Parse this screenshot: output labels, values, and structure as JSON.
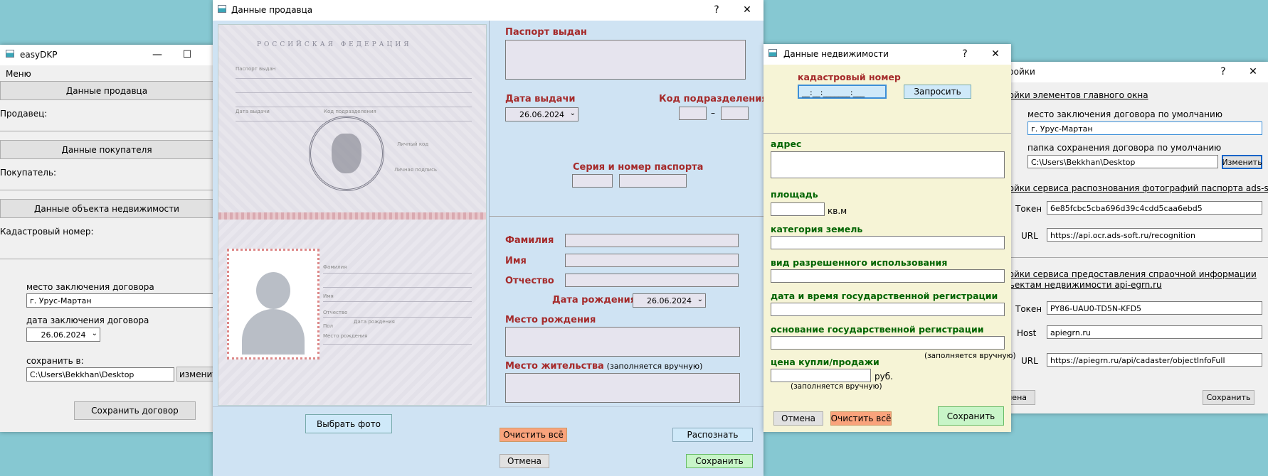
{
  "main_window": {
    "title": "easyDKP",
    "menu": "Меню",
    "seller_button": "Данные продавца",
    "seller_label": "Продавец:",
    "buyer_button": "Данные покупателя",
    "buyer_label": "Покупатель:",
    "property_button": "Данные объекта недвижимости",
    "cadastral_label": "Кадастровый номер:",
    "place_label": "место заключения договора",
    "place_value": "г. Урус-Мартан",
    "date_label": "дата заключения договора",
    "date_value": "26.06.2024",
    "save_to_label": "сохранить в:",
    "save_path": "C:\\Users\\Bekkhan\\Desktop",
    "change_button": "изменить",
    "save_contract_button": "Сохранить договор"
  },
  "seller_dialog": {
    "title": "Данные продавца",
    "help": "?",
    "close": "✕",
    "passport_image": {
      "header": "РОССИЙСКАЯ ФЕДЕРАЦИЯ",
      "issued_by": "Паспорт выдан",
      "issue_date": "Дата выдачи",
      "division_code": "Код подразделения",
      "personal_code": "Личный код",
      "personal_signature": "Личная подпись",
      "surname": "Фамилия",
      "name": "Имя",
      "patronymic": "Отчество",
      "sex": "Пол",
      "birth_date": "Дата рождения",
      "birth_place": "Место рождения"
    },
    "issued_by_label": "Паспорт выдан",
    "issue_date_label": "Дата выдачи",
    "issue_date_value": "26.06.2024",
    "division_code_label": "Код подразделения",
    "division_dash": "–",
    "series_label": "Серия и номер паспорта",
    "surname_label": "Фамилия",
    "name_label": "Имя",
    "patronymic_label": "Отчество",
    "birth_date_label": "Дата рождения",
    "birth_date_value": "26.06.2024",
    "birth_place_label": "Место рождения",
    "residence_label": "Место жительства",
    "residence_note": "(заполняется вручную)",
    "choose_photo_button": "Выбрать фото",
    "clear_all_button": "Очистить всё",
    "recognize_button": "Распознать",
    "cancel_button": "Отмена",
    "save_button": "Сохранить"
  },
  "property_dialog": {
    "title": "Данные недвижимости",
    "help": "?",
    "close": "✕",
    "cadastral_label": "кадастровый номер",
    "cadastral_mask": "__:__:_______:___",
    "request_button": "Запросить",
    "address_label": "адрес",
    "area_label": "площадь",
    "area_unit": "кв.м",
    "land_category_label": "категория земель",
    "permitted_use_label": "вид разрешенного использования",
    "registration_date_label": "дата и время государственной регистрации",
    "registration_basis_label": "основание государственной регистрации",
    "manual_note_1": "(заполняется вручную)",
    "price_label": "цена купли/продажи",
    "price_unit": "руб.",
    "manual_note_2": "(заполняется вручную)",
    "cancel_button": "Отмена",
    "clear_all_button": "Очистить всё",
    "save_button": "Сохранить"
  },
  "settings_dialog": {
    "title": "тройки",
    "help": "?",
    "close": "✕",
    "section_main": "ройки элементов главного окна",
    "default_place_label": "место заключения договора по умолчанию",
    "default_place_value": "г. Урус-Мартан",
    "default_folder_label": "папка сохранения договора по умолчанию",
    "default_folder_value": "C:\\Users\\Bekkhan\\Desktop",
    "change_button": "Изменить",
    "section_ocr": "ройки сервиса распознования фотографий паспорта ads-soft.ru",
    "ocr_token_label": "Токен",
    "ocr_token_value": "6e85fcbc5cba696d39c4cdd5caa6ebd5",
    "ocr_url_label": "URL",
    "ocr_url_value": "https://api.ocr.ads-soft.ru/recognition",
    "section_egrn_line1": "ройки сервиса предоставления спраочной информации",
    "section_egrn_line2": "бъектам недвижимости api-egrn.ru",
    "egrn_token_label": "Токен",
    "egrn_token_value": "PY86-UAU0-TD5N-KFD5",
    "egrn_host_label": "Host",
    "egrn_host_value": "apiegrn.ru",
    "egrn_url_label": "URL",
    "egrn_url_value": "https://apiegrn.ru/api/cadaster/objectInfoFull",
    "cancel_button": "мена",
    "save_button": "Сохранить"
  },
  "colors": {
    "desktop": "#86c8d2",
    "seller_bg": "#cfe3f3",
    "property_bg": "#f6f4d6",
    "red_label": "#a52a2a",
    "green_label": "#006400",
    "orange_button": "#f9a37c",
    "green_button": "#c8f5c8",
    "blue_button": "#cfe9f9"
  }
}
